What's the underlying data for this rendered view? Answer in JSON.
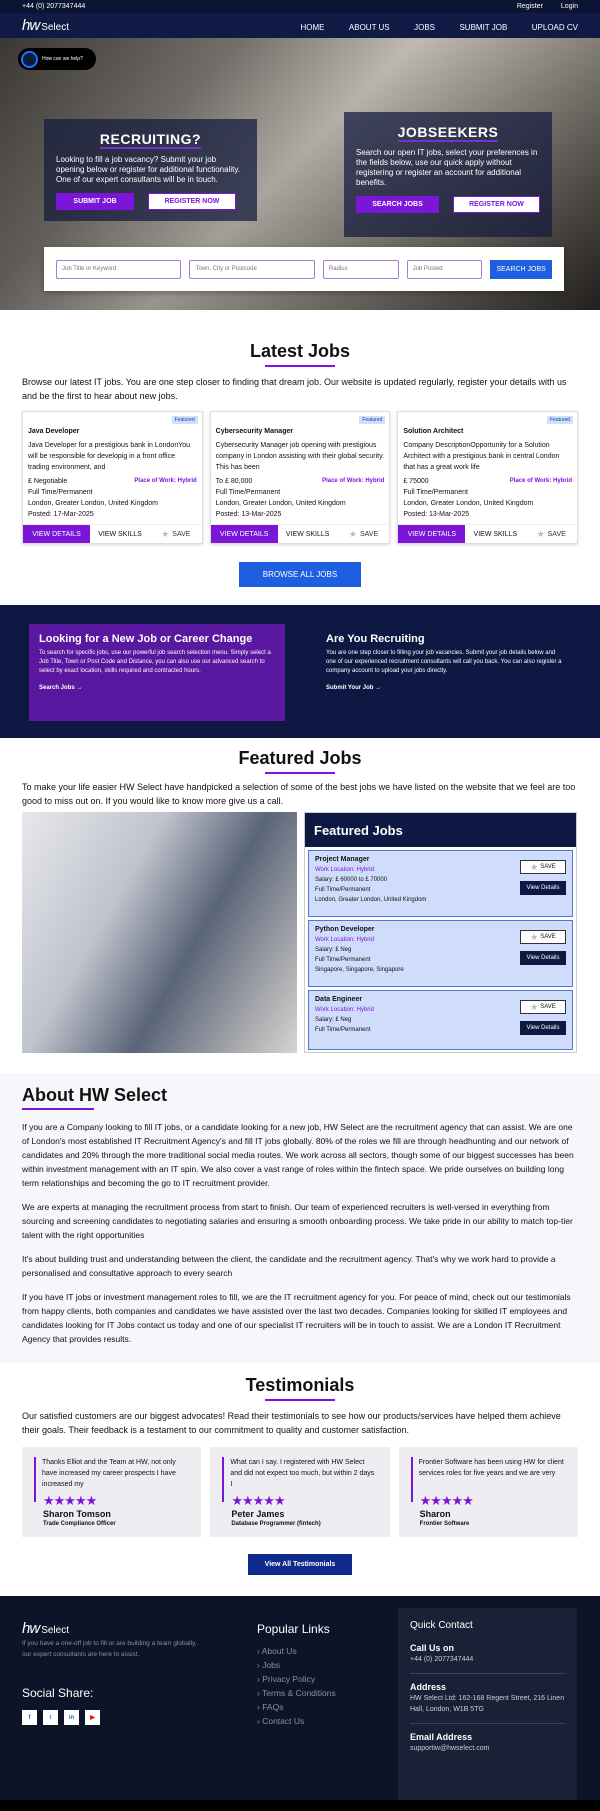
{
  "topbar": {
    "phone": "+44 (0) 2077347444",
    "register": "Register",
    "login": "Login"
  },
  "nav": {
    "logo_main": "hw",
    "logo_sub": "Select",
    "items": [
      "HOME",
      "ABOUT US",
      "JOBS",
      "SUBMIT JOB",
      "UPLOAD CV"
    ]
  },
  "help": "How can we help?",
  "recruiting": {
    "title": "RECRUITING?",
    "text": "Looking to fill a job vacancy? Submit your job opening below or register for additional functionality. One of our expert consultants will be in touch.",
    "btn1": "SUBMIT JOB",
    "btn2": "REGISTER NOW"
  },
  "jobseekers": {
    "title": "JOBSEEKERS",
    "text": "Search our open IT jobs, select your preferences in the fields below, use our quick apply without registering or register an account for additional benefits.",
    "btn1": "SEARCH JOBS",
    "btn2": "REGISTER NOW"
  },
  "search": {
    "kw": "Job Title or Keyword",
    "loc": "Town, City or Postcode",
    "radius": "Radius",
    "posted": "Job Posted",
    "btn": "SEARCH JOBS"
  },
  "latest": {
    "title": "Latest Jobs",
    "intro": "Browse our latest IT jobs. You are one step closer to finding that dream job. Our website is updated regularly, register your details with us and be the first to hear about new jobs.",
    "browse": "BROWSE ALL JOBS",
    "jobs": [
      {
        "badge": "Featured",
        "title": "Java Developer",
        "desc": "Java Developer for a prestigious bank in LondonYou will be responsible for developig in a front office trading environment, and",
        "salary": "£ Negotiable",
        "place": "Place of Work: Hybrid",
        "type": "Full Time/Permanent",
        "loc": "London, Greater London, United Kingdom",
        "posted": "Posted: 17-Mar-2025",
        "view": "VIEW DETAILS",
        "skills": "VIEW SKILLS",
        "save": "SAVE"
      },
      {
        "badge": "Featured",
        "title": "Cybersecurity Manager",
        "desc": "Cybersecurity Manager job opening with prestigious company in London assisting with their global security. This has been",
        "salary": "To £ 80,000",
        "place": "Place of Work: Hybrid",
        "type": "Full Time/Permanent",
        "loc": "London, Greater London, United Kingdom",
        "posted": "Posted: 13-Mar-2025",
        "view": "VIEW DETAILS",
        "skills": "VIEW SKILLS",
        "save": "SAVE"
      },
      {
        "badge": "Featured",
        "title": "Solution Architect",
        "desc": "Company DescriptionOpportunity for a Solution Architect with a prestigious bank in central London that has a great work life",
        "salary": "£ 75000",
        "place": "Place of Work: Hybrid",
        "type": "Full Time/Permanent",
        "loc": "London, Greater London, United Kingdom",
        "posted": "Posted: 13-Mar-2025",
        "view": "VIEW DETAILS",
        "skills": "VIEW SKILLS",
        "save": "SAVE"
      }
    ]
  },
  "cta": {
    "left_title": "Looking for a New Job or Career Change",
    "left_text": "To search for specific jobs, use our powerful job search selection menu. Simply select a Job Title, Town or Post Code and Distance, you can also use our advanced search to select by exact location, skills required and contracted hours.",
    "left_link": "Search Jobs →",
    "right_title": "Are You Recruiting",
    "right_text": "You are one step closer to filling your job vacancies. Submit your job details below and one of our experienced recruitment consultants will call you back. You can also register a company account to upload your jobs directly.",
    "right_link": "Submit Your Job →"
  },
  "featured": {
    "title": "Featured Jobs",
    "intro": "To make your life easier HW Select have handpicked a selection of some of the best jobs we have listed on the website that we feel are too good to miss out on. If you would like to know more give us a call.",
    "panel_title": "Featured Jobs",
    "jobs": [
      {
        "title": "Project Manager",
        "loc": "Work Location: Hybrid",
        "salary": "Salary: £ 60000 to £ 70000",
        "type": "Full Time/Permanent",
        "place": "London, Greater London, United Kingdom",
        "save": "SAVE",
        "view": "View Details"
      },
      {
        "title": "Python Developer",
        "loc": "Work Location: Hybrid",
        "salary": "Salary: £ Neg",
        "type": "Full Time/Permanent",
        "place": "Singapore, Singapore, Singapore",
        "save": "SAVE",
        "view": "View Details"
      },
      {
        "title": "Data Engineer",
        "loc": "Work Location: Hybrid",
        "salary": "Salary: £ Neg",
        "type": "Full Time/Permanent",
        "place": "",
        "save": "SAVE",
        "view": "View Details"
      }
    ]
  },
  "about": {
    "title": "About HW Select",
    "p1": "If you are a Company looking to fill IT jobs, or a candidate looking for a new job, HW Select are the recruitment agency that can assist. We are one of London's most established IT Recruitment Agency's and fill IT jobs globally. 80% of the roles we fill are through headhunting and our network of candidates and 20% through the more traditional social media routes. We work across all sectors, though some of our biggest successes has been within investment management with an IT spin. We also cover a vast range of roles within the fintech space. We pride ourselves on building long term relationships and becoming the go to IT recruitment provider.",
    "p2": "We are experts at managing the recruitment process from start to finish. Our team of experienced recruiters is well-versed in everything from sourcing and screening candidates to negotiating salaries and ensuring a smooth onboarding process. We take pride in our ability to match top-tier talent with the right opportunities",
    "p3": "It's about building trust and understanding between the client, the candidate and the recruitment agency. That's why we work hard to provide a personalised and consultative approach to every search",
    "p4": "If you have IT jobs or investment management roles to fill, we are the IT recruitment agency for you. For peace of mind, check out our testimonials from happy clients, both companies and candidates we have assisted over the last two decades. Companies looking for skilled IT employees and candidates looking for IT Jobs contact us today and one of our specialist IT recruiters will be in touch to assist. We are a London IT Recruitment Agency that provides results."
  },
  "testimonials": {
    "title": "Testimonials",
    "intro": "Our satisfied customers are our biggest advocates! Read their testimonials to see how our products/services have helped them achieve their goals. Their feedback is a testament to our commitment to quality and customer satisfaction.",
    "button": "View All Testimonials",
    "items": [
      {
        "quote": "Thanks Elliot and the Team at HW, not only have increased my career prospects I have increased my",
        "stars": "★★★★★",
        "name": "Sharon Tomson",
        "role": "Trade Compliance Officer"
      },
      {
        "quote": "What can I say. I registered with HW Select and did not expect too much, but within 2 days I",
        "stars": "★★★★★",
        "name": "Peter James",
        "role": "Database Programmer (fintech)"
      },
      {
        "quote": "Frontier Software has been using HW for client services roles for five years and we are very",
        "stars": "★★★★★",
        "name": "Sharon",
        "role": "Frontier Software"
      }
    ]
  },
  "footer": {
    "logo_main": "hw",
    "logo_sub": "Select",
    "desc": "If you have a one-off job to fill or are building a team globally, our expert consultants are here to assist.",
    "share": "Social Share:",
    "socials": [
      "f",
      "t",
      "in",
      "▶"
    ],
    "popular_title": "Popular Links",
    "links": [
      "About Us",
      "Jobs",
      "Privacy Policy",
      "Terms & Conditions",
      "FAQs",
      "Contact Us"
    ],
    "quick_title": "Quick Contact",
    "call_label": "Call Us on",
    "call": "+44 (0) 2077347444",
    "addr_label": "Address",
    "addr": "HW Select Ltd: 162-168 Regent Street, 216 Linen Hall, London, W1B 5TG",
    "email_label": "Email Address",
    "email": "supportiw@hwselect.com"
  },
  "colors": {
    "navy": "#101a44",
    "purple": "#7b16d8",
    "blue": "#1d5fe0"
  }
}
